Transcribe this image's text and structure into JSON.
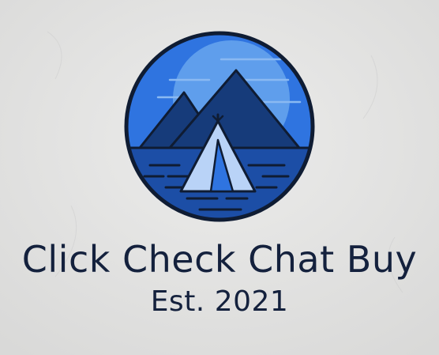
{
  "brand": {
    "name": "Click Check Chat Buy",
    "established": "Est. 2021",
    "logo_icon": "mountain-tent-lake-icon"
  },
  "colors": {
    "background": "#e4e4e3",
    "text": "#14213d",
    "sky": "#2f74e0",
    "sun": "#5f9eec",
    "mountain": "#163b7a",
    "water": "#1c4ea6",
    "tent": "#b9d3f7",
    "outline": "#0f1c33"
  }
}
